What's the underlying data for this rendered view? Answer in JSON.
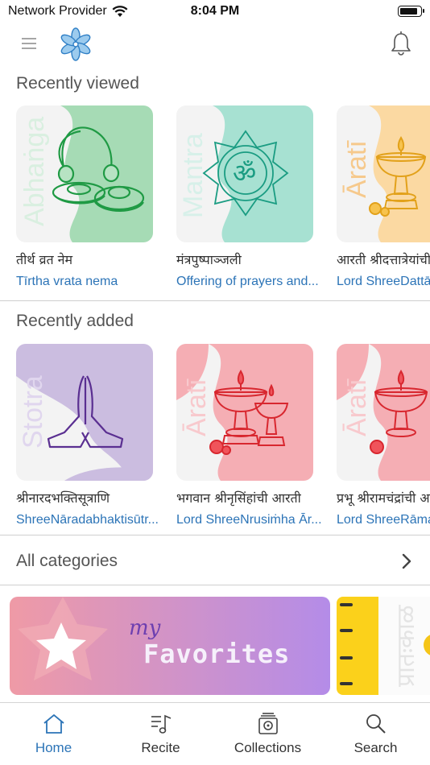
{
  "status_bar": {
    "carrier": "Network Provider",
    "time": "8:04 PM",
    "battery_level": 0.9
  },
  "header": {
    "menu_icon": "hamburger-menu-icon",
    "logo_icon": "lotus-logo-icon",
    "bell_icon": "bell-icon"
  },
  "recently_viewed": {
    "title": "Recently viewed",
    "items": [
      {
        "category": "Abhaṅga",
        "title": "तीर्थ व्रत नेम",
        "subtitle": "Tīrtha vrata nema",
        "icon": "cymbals-icon",
        "color": "#a6dbb5"
      },
      {
        "category": "Mantra",
        "title": "मंत्रपुष्पाञ्जली",
        "subtitle": "Offering of prayers and...",
        "icon": "om-mandala-icon",
        "color": "#a7e1d2"
      },
      {
        "category": "Āratī",
        "title": "आरती श्रीदत्तात्रेयांची",
        "subtitle": "Lord ShreeDattātreya",
        "icon": "lamp-icon",
        "color": "#fbd9a2"
      }
    ]
  },
  "recently_added": {
    "title": "Recently added",
    "items": [
      {
        "category": "Stotra",
        "title": "श्रीनारदभक्तिसूत्राणि",
        "subtitle": "ShreeNāradabhaktisūtr...",
        "icon": "praying-hands-icon",
        "color": "#cbbde0"
      },
      {
        "category": "Āratī",
        "title": "भगवान श्रीनृसिंहांची आरती",
        "subtitle": "Lord ShreeNrusiṁha Ār...",
        "icon": "lamp-icon",
        "color": "#f5aeb4"
      },
      {
        "category": "Āratī",
        "title": "प्रभू श्रीरामचंद्रांची आरती",
        "subtitle": "Lord ShreeRāmachandra",
        "icon": "lamp-icon",
        "color": "#f5aeb4"
      }
    ]
  },
  "all_categories": {
    "label": "All categories"
  },
  "banners": {
    "favorites": {
      "prefix": "my",
      "title": "Favorites",
      "icon": "star-icon"
    },
    "notebook": {
      "text": "प्रातःकाळ",
      "icon": "sun-icon"
    }
  },
  "tabs": [
    {
      "label": "Home",
      "icon": "home-icon",
      "active": true
    },
    {
      "label": "Recite",
      "icon": "music-note-icon",
      "active": false
    },
    {
      "label": "Collections",
      "icon": "collections-icon",
      "active": false
    },
    {
      "label": "Search",
      "icon": "search-icon",
      "active": false
    }
  ],
  "colors": {
    "accent": "#2c74b7",
    "text": "#333333",
    "section_title": "#555555"
  }
}
